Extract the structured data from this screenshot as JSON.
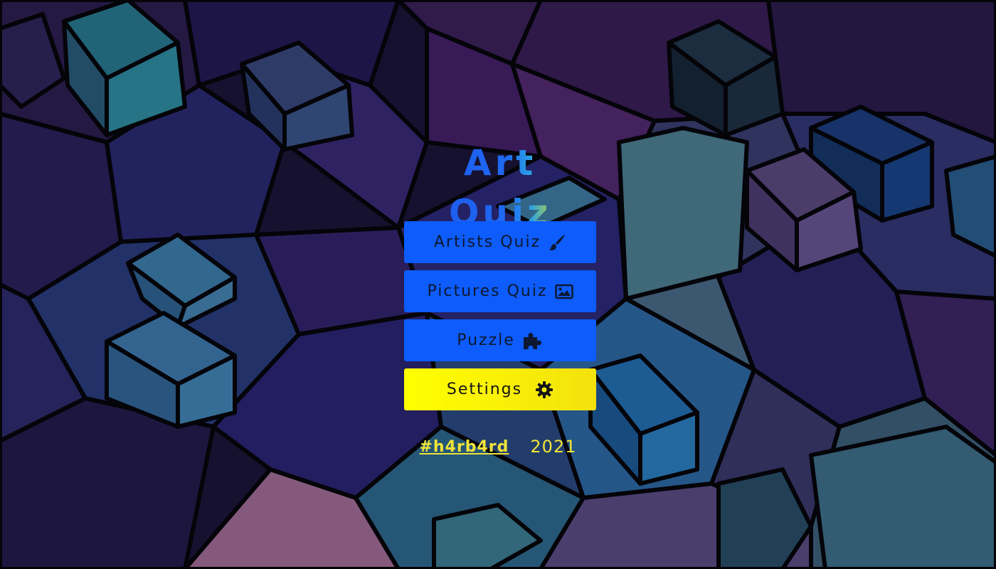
{
  "app": {
    "title": "Art Quiz"
  },
  "menu": {
    "artists_quiz": {
      "label": "Artists Quiz",
      "icon": "paintbrush-icon"
    },
    "pictures_quiz": {
      "label": "Pictures Quiz",
      "icon": "image-icon"
    },
    "puzzle": {
      "label": "Puzzle",
      "icon": "puzzle-piece-icon"
    },
    "settings": {
      "label": "Settings",
      "icon": "gear-icon"
    }
  },
  "footer": {
    "author_link": "#h4rb4rd",
    "year": "2021"
  },
  "colors": {
    "button_blue": "#0d5cfb",
    "button_yellow": "#ffff00",
    "footer_text": "#f0e43a"
  }
}
